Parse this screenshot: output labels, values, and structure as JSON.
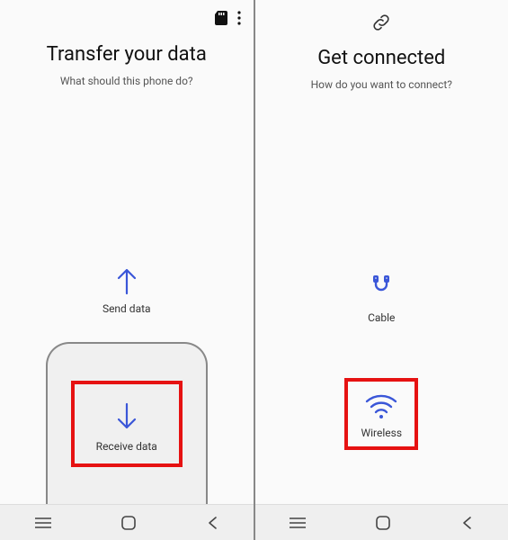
{
  "left": {
    "title": "Transfer your data",
    "subtitle": "What should this phone do?",
    "send_label": "Send data",
    "receive_label": "Receive data"
  },
  "right": {
    "title": "Get connected",
    "subtitle": "How do you want to connect?",
    "cable_label": "Cable",
    "wireless_label": "Wireless"
  },
  "colors": {
    "accent": "#3a56d8",
    "highlight": "#e61212"
  }
}
